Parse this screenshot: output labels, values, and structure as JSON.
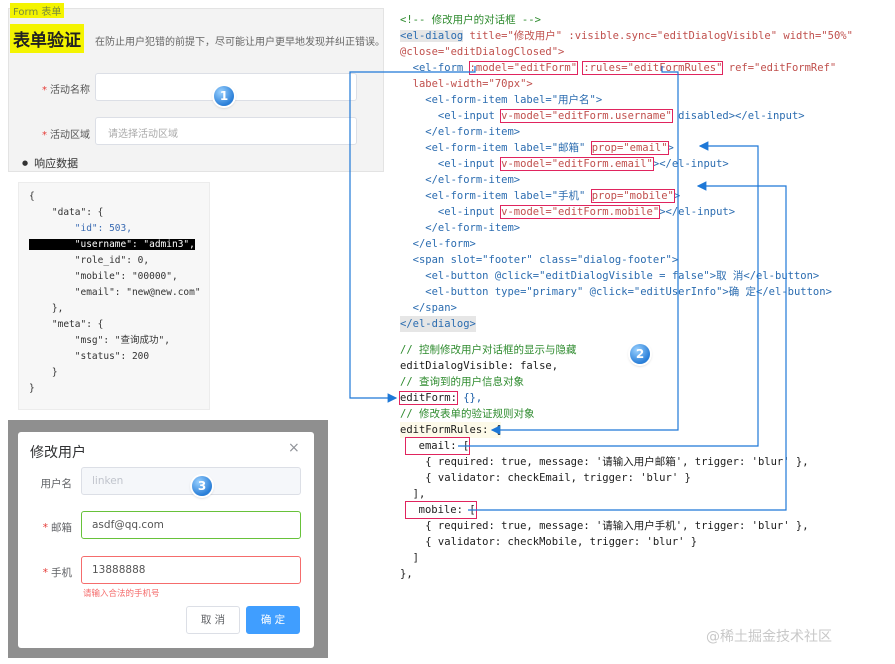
{
  "form_demo": {
    "crumb": "Form 表单",
    "title": "表单验证",
    "description": "在防止用户犯错的前提下，尽可能让用户更早地发现并纠正错误。",
    "activity_label": "活动名称",
    "area_label": "活动区域",
    "area_placeholder": "请选择活动区域",
    "response_title": "响应数据"
  },
  "badges": {
    "one": "1",
    "two": "2",
    "three": "3"
  },
  "json_lines": [
    "{",
    "    \"data\": {",
    "        \"id\": 503,",
    "        \"username\": \"admin3\",",
    "        \"role_id\": 0,",
    "        \"mobile\": \"00000\",",
    "        \"email\": \"new@new.com\"",
    "    },",
    "    \"meta\": {",
    "        \"msg\": \"查询成功\",",
    "        \"status\": 200",
    "    }",
    "}"
  ],
  "dialog": {
    "title": "修改用户",
    "close": "×",
    "username_label": "用户名",
    "username_value": "linken",
    "email_label": "邮箱",
    "email_value": "asdf@qq.com",
    "mobile_label": "手机",
    "mobile_value": "13888888",
    "mobile_error": "请输入合法的手机号",
    "cancel": "取 消",
    "ok": "确 定"
  },
  "code": {
    "l1": "<!-- 修改用户的对话框 -->",
    "l2a": "<el-dialog",
    "l2b": " title=\"修改用户\" :visible.sync=\"editDialogVisible\" width=\"50%\"",
    "l3": "@close=\"editDialogClosed\">",
    "l4a": "  <el-form ",
    "l4b": ":model=\"editForm\"",
    "l4c": " ",
    "l4d": ":rules=\"editFormRules\"",
    "l4e": " ref=\"editFormRef\"",
    "l5": "  label-width=\"70px\">",
    "l6": "    <el-form-item label=\"用户名\">",
    "l7a": "      <el-input ",
    "l7b": "v-model=\"editForm.username\"",
    "l7c": " disabled></el-input>",
    "l8": "    </el-form-item>",
    "l9a": "    <el-form-item label=\"邮箱\" ",
    "l9b": "prop=\"email\"",
    "l9c": ">",
    "l10a": "      <el-input ",
    "l10b": "v-model=\"editForm.email\"",
    "l10c": "></el-input>",
    "l11": "    </el-form-item>",
    "l12a": "    <el-form-item label=\"手机\" ",
    "l12b": "prop=\"mobile\"",
    "l12c": ">",
    "l13a": "      <el-input ",
    "l13b": "v-model=\"editForm.mobile\"",
    "l13c": "></el-input>",
    "l14": "    </el-form-item>",
    "l15": "  </el-form>",
    "l16": "  <span slot=\"footer\" class=\"dialog-footer\">",
    "l17": "    <el-button @click=\"editDialogVisible = false\">取 消</el-button>",
    "l18": "    <el-button type=\"primary\" @click=\"editUserInfo\">确 定</el-button>",
    "l19": "  </span>",
    "l20": "</el-dialog>",
    "c1": "// 控制修改用户对话框的显示与隐藏",
    "c2": "editDialogVisible: false,",
    "c3": "// 查询到的用户信息对象",
    "c4a": "editForm:",
    "c4b": " {},",
    "c5": "// 修改表单的验证规则对象",
    "c6": "editFormRules: {",
    "c7": "  email: [",
    "c8": "    { required: true, message: '请输入用户邮箱', trigger: 'blur' },",
    "c9": "    { validator: checkEmail, trigger: 'blur' }",
    "c10": "  ],",
    "c11": "  mobile: [",
    "c12": "    { required: true, message: '请输入用户手机', trigger: 'blur' },",
    "c13": "    { validator: checkMobile, trigger: 'blur' }",
    "c14": "  ]",
    "c15": "},"
  },
  "colors": {
    "highlight_yellow": "#f4f400",
    "box_red": "#e0245e",
    "arrow_blue": "#1e78d7",
    "primary": "#409eff",
    "error": "#f56c6c",
    "success": "#67c23a"
  },
  "watermark": "@稀土掘金技术社区"
}
